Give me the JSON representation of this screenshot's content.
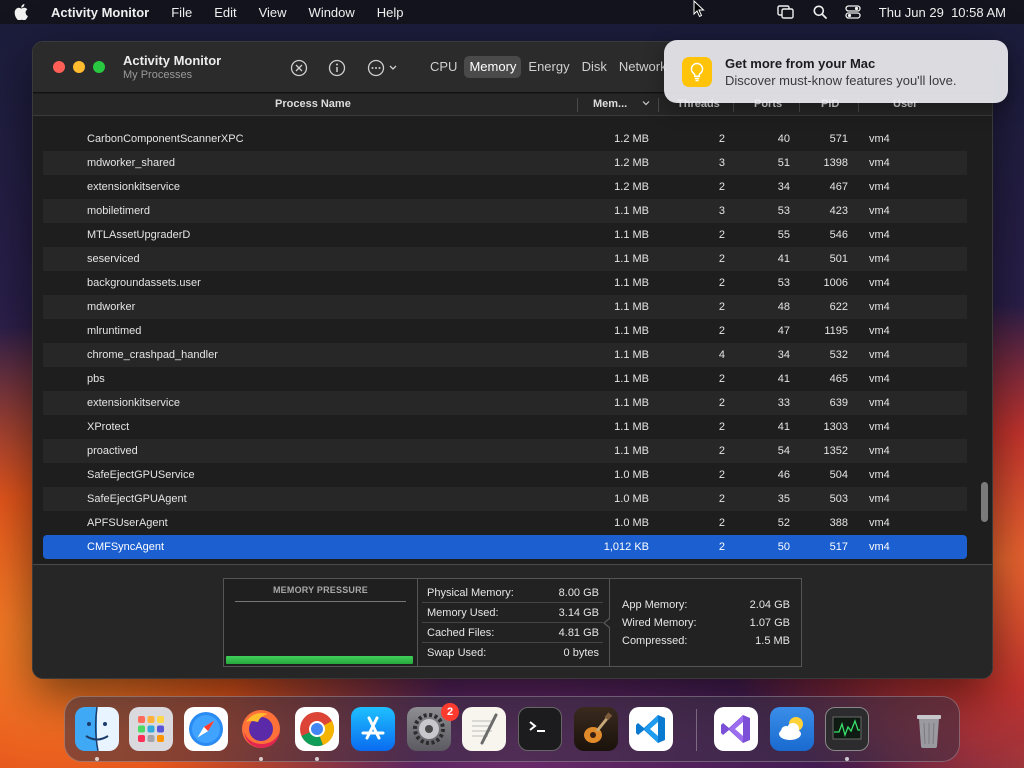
{
  "menubar": {
    "app_name": "Activity Monitor",
    "items": [
      "File",
      "Edit",
      "View",
      "Window",
      "Help"
    ],
    "clock": "Thu Jun 29  10:58 AM"
  },
  "window": {
    "title": "Activity Monitor",
    "subtitle": "My Processes",
    "tabs": [
      {
        "label": "CPU",
        "active": false
      },
      {
        "label": "Memory",
        "active": true
      },
      {
        "label": "Energy",
        "active": false
      },
      {
        "label": "Disk",
        "active": false
      },
      {
        "label": "Network",
        "active": false
      }
    ]
  },
  "table": {
    "columns": {
      "name": "Process Name",
      "memory": "Mem...",
      "threads": "Threads",
      "ports": "Ports",
      "pid": "PID",
      "user": "User"
    },
    "rows": [
      {
        "name": "CarbonComponentScannerXPC",
        "memory": "1.2 MB",
        "threads": "2",
        "ports": "40",
        "pid": "571",
        "user": "vm4"
      },
      {
        "name": "mdworker_shared",
        "memory": "1.2 MB",
        "threads": "3",
        "ports": "51",
        "pid": "1398",
        "user": "vm4"
      },
      {
        "name": "extensionkitservice",
        "memory": "1.2 MB",
        "threads": "2",
        "ports": "34",
        "pid": "467",
        "user": "vm4"
      },
      {
        "name": "mobiletimerd",
        "memory": "1.1 MB",
        "threads": "3",
        "ports": "53",
        "pid": "423",
        "user": "vm4"
      },
      {
        "name": "MTLAssetUpgraderD",
        "memory": "1.1 MB",
        "threads": "2",
        "ports": "55",
        "pid": "546",
        "user": "vm4"
      },
      {
        "name": "seserviced",
        "memory": "1.1 MB",
        "threads": "2",
        "ports": "41",
        "pid": "501",
        "user": "vm4"
      },
      {
        "name": "backgroundassets.user",
        "memory": "1.1 MB",
        "threads": "2",
        "ports": "53",
        "pid": "1006",
        "user": "vm4"
      },
      {
        "name": "mdworker",
        "memory": "1.1 MB",
        "threads": "2",
        "ports": "48",
        "pid": "622",
        "user": "vm4"
      },
      {
        "name": "mlruntimed",
        "memory": "1.1 MB",
        "threads": "2",
        "ports": "47",
        "pid": "1195",
        "user": "vm4"
      },
      {
        "name": "chrome_crashpad_handler",
        "memory": "1.1 MB",
        "threads": "4",
        "ports": "34",
        "pid": "532",
        "user": "vm4"
      },
      {
        "name": "pbs",
        "memory": "1.1 MB",
        "threads": "2",
        "ports": "41",
        "pid": "465",
        "user": "vm4"
      },
      {
        "name": "extensionkitservice",
        "memory": "1.1 MB",
        "threads": "2",
        "ports": "33",
        "pid": "639",
        "user": "vm4"
      },
      {
        "name": "XProtect",
        "memory": "1.1 MB",
        "threads": "2",
        "ports": "41",
        "pid": "1303",
        "user": "vm4"
      },
      {
        "name": "proactived",
        "memory": "1.1 MB",
        "threads": "2",
        "ports": "54",
        "pid": "1352",
        "user": "vm4"
      },
      {
        "name": "SafeEjectGPUService",
        "memory": "1.0 MB",
        "threads": "2",
        "ports": "46",
        "pid": "504",
        "user": "vm4"
      },
      {
        "name": "SafeEjectGPUAgent",
        "memory": "1.0 MB",
        "threads": "2",
        "ports": "35",
        "pid": "503",
        "user": "vm4"
      },
      {
        "name": "APFSUserAgent",
        "memory": "1.0 MB",
        "threads": "2",
        "ports": "52",
        "pid": "388",
        "user": "vm4"
      },
      {
        "name": "CMFSyncAgent",
        "memory": "1,012 KB",
        "threads": "2",
        "ports": "50",
        "pid": "517",
        "user": "vm4"
      }
    ],
    "selected_index": 17
  },
  "memory": {
    "pressure_title": "MEMORY PRESSURE",
    "pressure_fraction": 0.99,
    "physical_label": "Physical Memory:",
    "physical_value": "8.00 GB",
    "used_label": "Memory Used:",
    "used_value": "3.14 GB",
    "cached_label": "Cached Files:",
    "cached_value": "4.81 GB",
    "swap_label": "Swap Used:",
    "swap_value": "0 bytes",
    "app_label": "App Memory:",
    "app_value": "2.04 GB",
    "wired_label": "Wired Memory:",
    "wired_value": "1.07 GB",
    "compressed_label": "Compressed:",
    "compressed_value": "1.5 MB"
  },
  "notification": {
    "title": "Get more from your Mac",
    "body": "Discover must-know features you'll love."
  },
  "dock": {
    "apps": [
      {
        "name": "finder-icon",
        "running": true
      },
      {
        "name": "launchpad-icon",
        "running": false
      },
      {
        "name": "safari-icon",
        "running": false
      },
      {
        "name": "firefox-icon",
        "running": true
      },
      {
        "name": "chrome-icon",
        "running": true
      },
      {
        "name": "app-store-icon",
        "running": false
      },
      {
        "name": "system-settings-icon",
        "running": false,
        "badge": "2"
      },
      {
        "name": "textedit-icon",
        "running": false
      },
      {
        "name": "terminal-icon",
        "running": false
      },
      {
        "name": "garageband-icon",
        "running": false
      },
      {
        "name": "vscode-icon",
        "running": false
      },
      {
        "name": "visual-studio-icon",
        "running": false
      },
      {
        "name": "weather-icon",
        "running": false
      },
      {
        "name": "activity-monitor-icon",
        "running": true
      },
      {
        "name": "trash-icon",
        "running": false
      }
    ]
  },
  "colors": {
    "selection": "#1b5fd1",
    "pressure_green": "#32b84a",
    "notification_icon": "#ffc40a"
  }
}
